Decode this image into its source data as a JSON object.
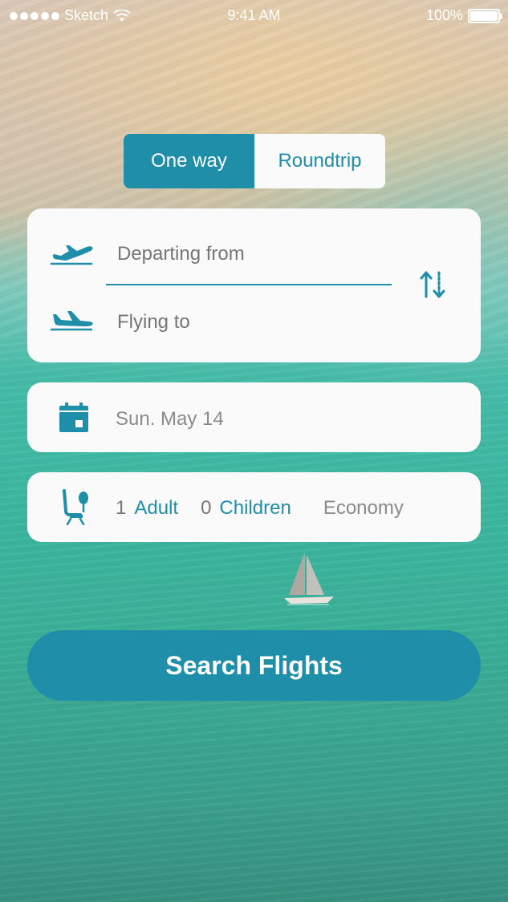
{
  "status_bar": {
    "carrier": "Sketch",
    "time": "9:41 AM",
    "battery": "100%"
  },
  "trip_type": {
    "options": [
      {
        "label": "One way",
        "selected": true
      },
      {
        "label": "Roundtrip",
        "selected": false
      }
    ]
  },
  "route": {
    "from_placeholder": "Departing from",
    "to_placeholder": "Flying to",
    "icons": {
      "from": "airplane-departure-icon",
      "to": "airplane-arrival-icon",
      "swap": "swap-arrows-icon"
    }
  },
  "date": {
    "value": "Sun. May 14",
    "icon": "calendar-icon"
  },
  "passengers": {
    "adult_count": "1",
    "adult_label": "Adult",
    "children_count": "0",
    "children_label": "Children",
    "cabin_class": "Economy",
    "icon": "seat-icon"
  },
  "search": {
    "label": "Search Flights"
  },
  "colors": {
    "accent": "#1f8ea8",
    "card": "#fafafa",
    "placeholder": "#8a8a8a"
  }
}
